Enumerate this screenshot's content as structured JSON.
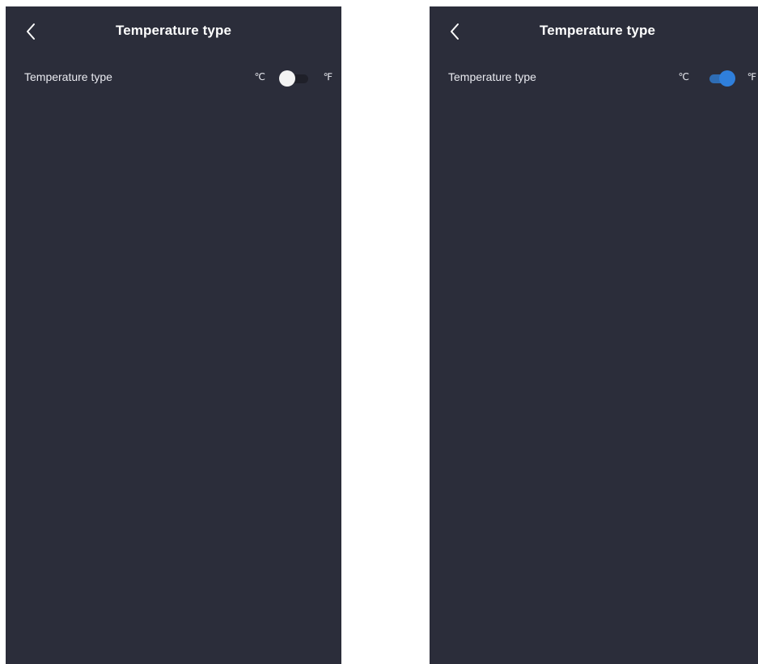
{
  "screens": [
    {
      "title": "Temperature type",
      "setting": {
        "label": "Temperature type",
        "unit_left": "℃",
        "unit_right": "℉",
        "toggle_state": "off"
      }
    },
    {
      "title": "Temperature type",
      "setting": {
        "label": "Temperature type",
        "unit_left": "℃",
        "unit_right": "℉",
        "toggle_state": "on"
      }
    }
  ],
  "colors": {
    "background": "#2b2d3a",
    "toggle_on_accent": "#2f7fdb",
    "toggle_off_knob": "#f3f3f3"
  },
  "icons": {
    "back": "chevron-left-icon"
  }
}
